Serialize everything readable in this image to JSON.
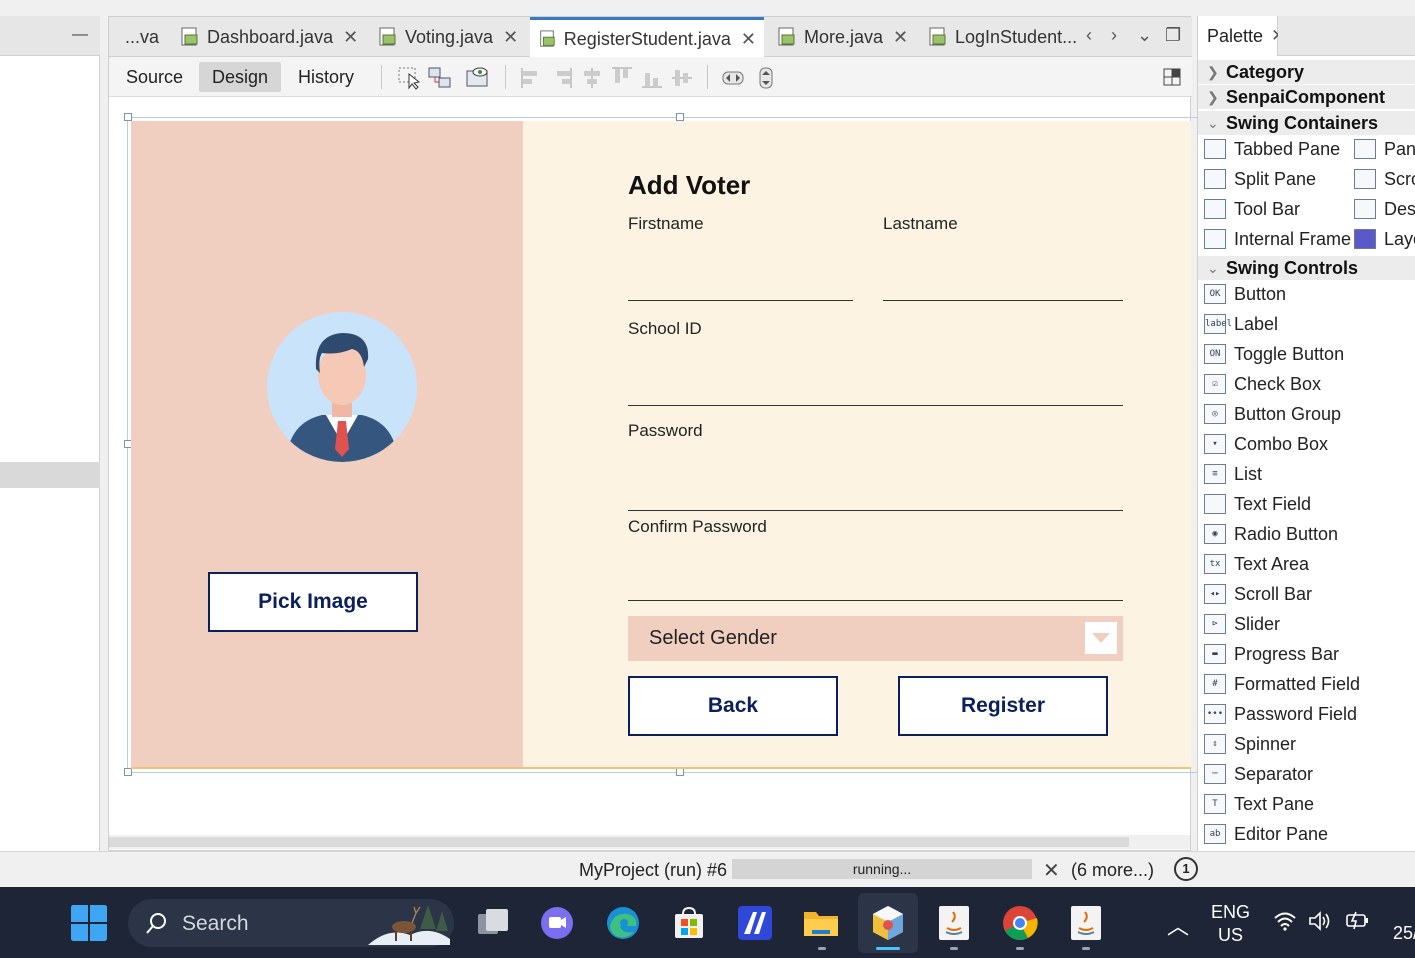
{
  "left_panel": {
    "minimize_symbol": "—"
  },
  "editor": {
    "tabs": [
      {
        "label": "...va"
      },
      {
        "label": "Dashboard.java"
      },
      {
        "label": "Voting.java"
      },
      {
        "label": "RegisterStudent.java"
      },
      {
        "label": "More.java"
      },
      {
        "label": "LogInStudent..."
      }
    ],
    "views": {
      "source": "Source",
      "design": "Design",
      "history": "History"
    }
  },
  "form": {
    "title": "Add Voter",
    "firstname_label": "Firstname",
    "lastname_label": "Lastname",
    "schoolid_label": "School ID",
    "password_label": "Password",
    "confirm_label": "Confirm Password",
    "gender_placeholder": "Select Gender",
    "pick_image": "Pick Image",
    "back": "Back",
    "register": "Register",
    "colors": {
      "left": "#f1cfc0",
      "right": "#fdf3e3",
      "button_text": "#0b1f5c"
    }
  },
  "palette": {
    "title": "Palette",
    "categories": {
      "category": "Category",
      "senpai": "SenpaiComponent",
      "containers": "Swing Containers",
      "controls": "Swing Controls"
    },
    "containers": [
      {
        "label": "Tabbed Pane"
      },
      {
        "label": "Pane"
      },
      {
        "label": "Split Pane"
      },
      {
        "label": "Scro"
      },
      {
        "label": "Tool Bar"
      },
      {
        "label": "Desk"
      },
      {
        "label": "Internal Frame"
      },
      {
        "label": "Laye"
      }
    ],
    "controls": [
      {
        "label": "Button",
        "icon": "OK"
      },
      {
        "label": "Label",
        "icon": "label"
      },
      {
        "label": "Toggle Button",
        "icon": "ON"
      },
      {
        "label": "Check Box",
        "icon": "☑"
      },
      {
        "label": "Button Group",
        "icon": "◎"
      },
      {
        "label": "Combo Box",
        "icon": "▾"
      },
      {
        "label": "List",
        "icon": "≡"
      },
      {
        "label": "Text Field",
        "icon": ""
      },
      {
        "label": "Radio Button",
        "icon": "◉"
      },
      {
        "label": "Text Area",
        "icon": "tx"
      },
      {
        "label": "Scroll Bar",
        "icon": "◂▸"
      },
      {
        "label": "Slider",
        "icon": "⊳"
      },
      {
        "label": "Progress Bar",
        "icon": "▬"
      },
      {
        "label": "Formatted Field",
        "icon": "#"
      },
      {
        "label": "Password Field",
        "icon": "•••"
      },
      {
        "label": "Spinner",
        "icon": "⇕"
      },
      {
        "label": "Separator",
        "icon": "─"
      },
      {
        "label": "Text Pane",
        "icon": "T"
      },
      {
        "label": "Editor Pane",
        "icon": "ab"
      }
    ]
  },
  "status": {
    "project": "MyProject (run) #6",
    "progress": "running...",
    "close": "✕",
    "more": "(6 more...)",
    "notifications": "1"
  },
  "taskbar": {
    "search": "Search",
    "lang1": "ENG",
    "lang2": "US",
    "date_fragment": "25/"
  }
}
